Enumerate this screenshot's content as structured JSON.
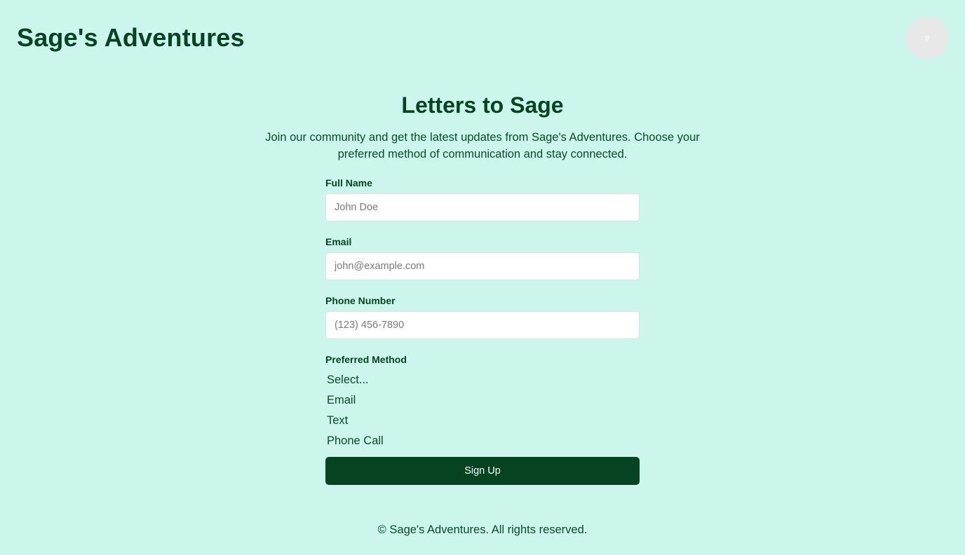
{
  "header": {
    "site_title": "Sage's Adventures",
    "avatar_glyph": "#"
  },
  "main": {
    "heading": "Letters to Sage",
    "intro": "Join our community and get the latest updates from Sage's Adventures. Choose your preferred method of communication and stay connected."
  },
  "form": {
    "full_name": {
      "label": "Full Name",
      "placeholder": "John Doe",
      "value": ""
    },
    "email": {
      "label": "Email",
      "placeholder": "john@example.com",
      "value": ""
    },
    "phone": {
      "label": "Phone Number",
      "placeholder": "(123) 456-7890",
      "value": ""
    },
    "preferred_method": {
      "label": "Preferred Method",
      "options": [
        "Select...",
        "Email",
        "Text",
        "Phone Call"
      ]
    },
    "submit_label": "Sign Up"
  },
  "footer": {
    "text": "© Sage's Adventures. All rights reserved."
  },
  "colors": {
    "background": "#ccf6ec",
    "primary": "#064321",
    "input_bg": "#ffffff",
    "avatar_bg": "#e8e8e8"
  }
}
